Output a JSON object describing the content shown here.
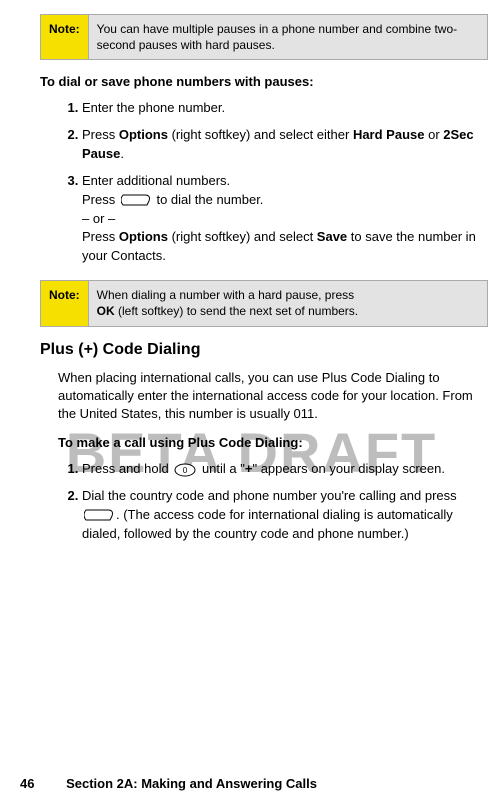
{
  "note1": {
    "label": "Note:",
    "text": "You can have multiple pauses in a phone number and combine two-second pauses with hard pauses."
  },
  "heading1": "To dial or save phone numbers with pauses:",
  "steps1": {
    "s1": "Enter the phone number.",
    "s2_a": "Press ",
    "s2_b": "Options",
    "s2_c": " (right softkey) and select either ",
    "s2_d": "Hard Pause",
    "s2_e": " or ",
    "s2_f": "2Sec Pause",
    "s2_g": ".",
    "s3_a": "Enter additional numbers.",
    "s3_b": "Press ",
    "s3_c": " to dial the number.",
    "s3_d": "– or –",
    "s3_e": "Press ",
    "s3_f": "Options",
    "s3_g": " (right softkey) and select ",
    "s3_h": "Save",
    "s3_i": " to save the number in your Contacts."
  },
  "note2": {
    "label": "Note:",
    "text_a": "When dialing a number with a hard pause, press ",
    "text_b": "OK",
    "text_c": " (left softkey) to send the next set of numbers."
  },
  "heading2": "Plus (+) Code Dialing",
  "body2": "When placing international calls, you can use Plus Code Dialing to automatically enter the international access code for your location. From the United States, this number is usually 011.",
  "heading3": "To make a call using Plus Code Dialing:",
  "steps2": {
    "s1_a": "Press and hold ",
    "s1_b": " until a \"",
    "s1_c": "+",
    "s1_d": "\" appears on your display screen.",
    "s2_a": "Dial the country code and phone number you're calling and press ",
    "s2_b": ". (The access code for international dialing is automatically dialed, followed by the country code and phone number.)"
  },
  "watermark": "BETA DRAFT",
  "footer": {
    "page": "46",
    "section": "Section 2A: Making and Answering Calls"
  }
}
